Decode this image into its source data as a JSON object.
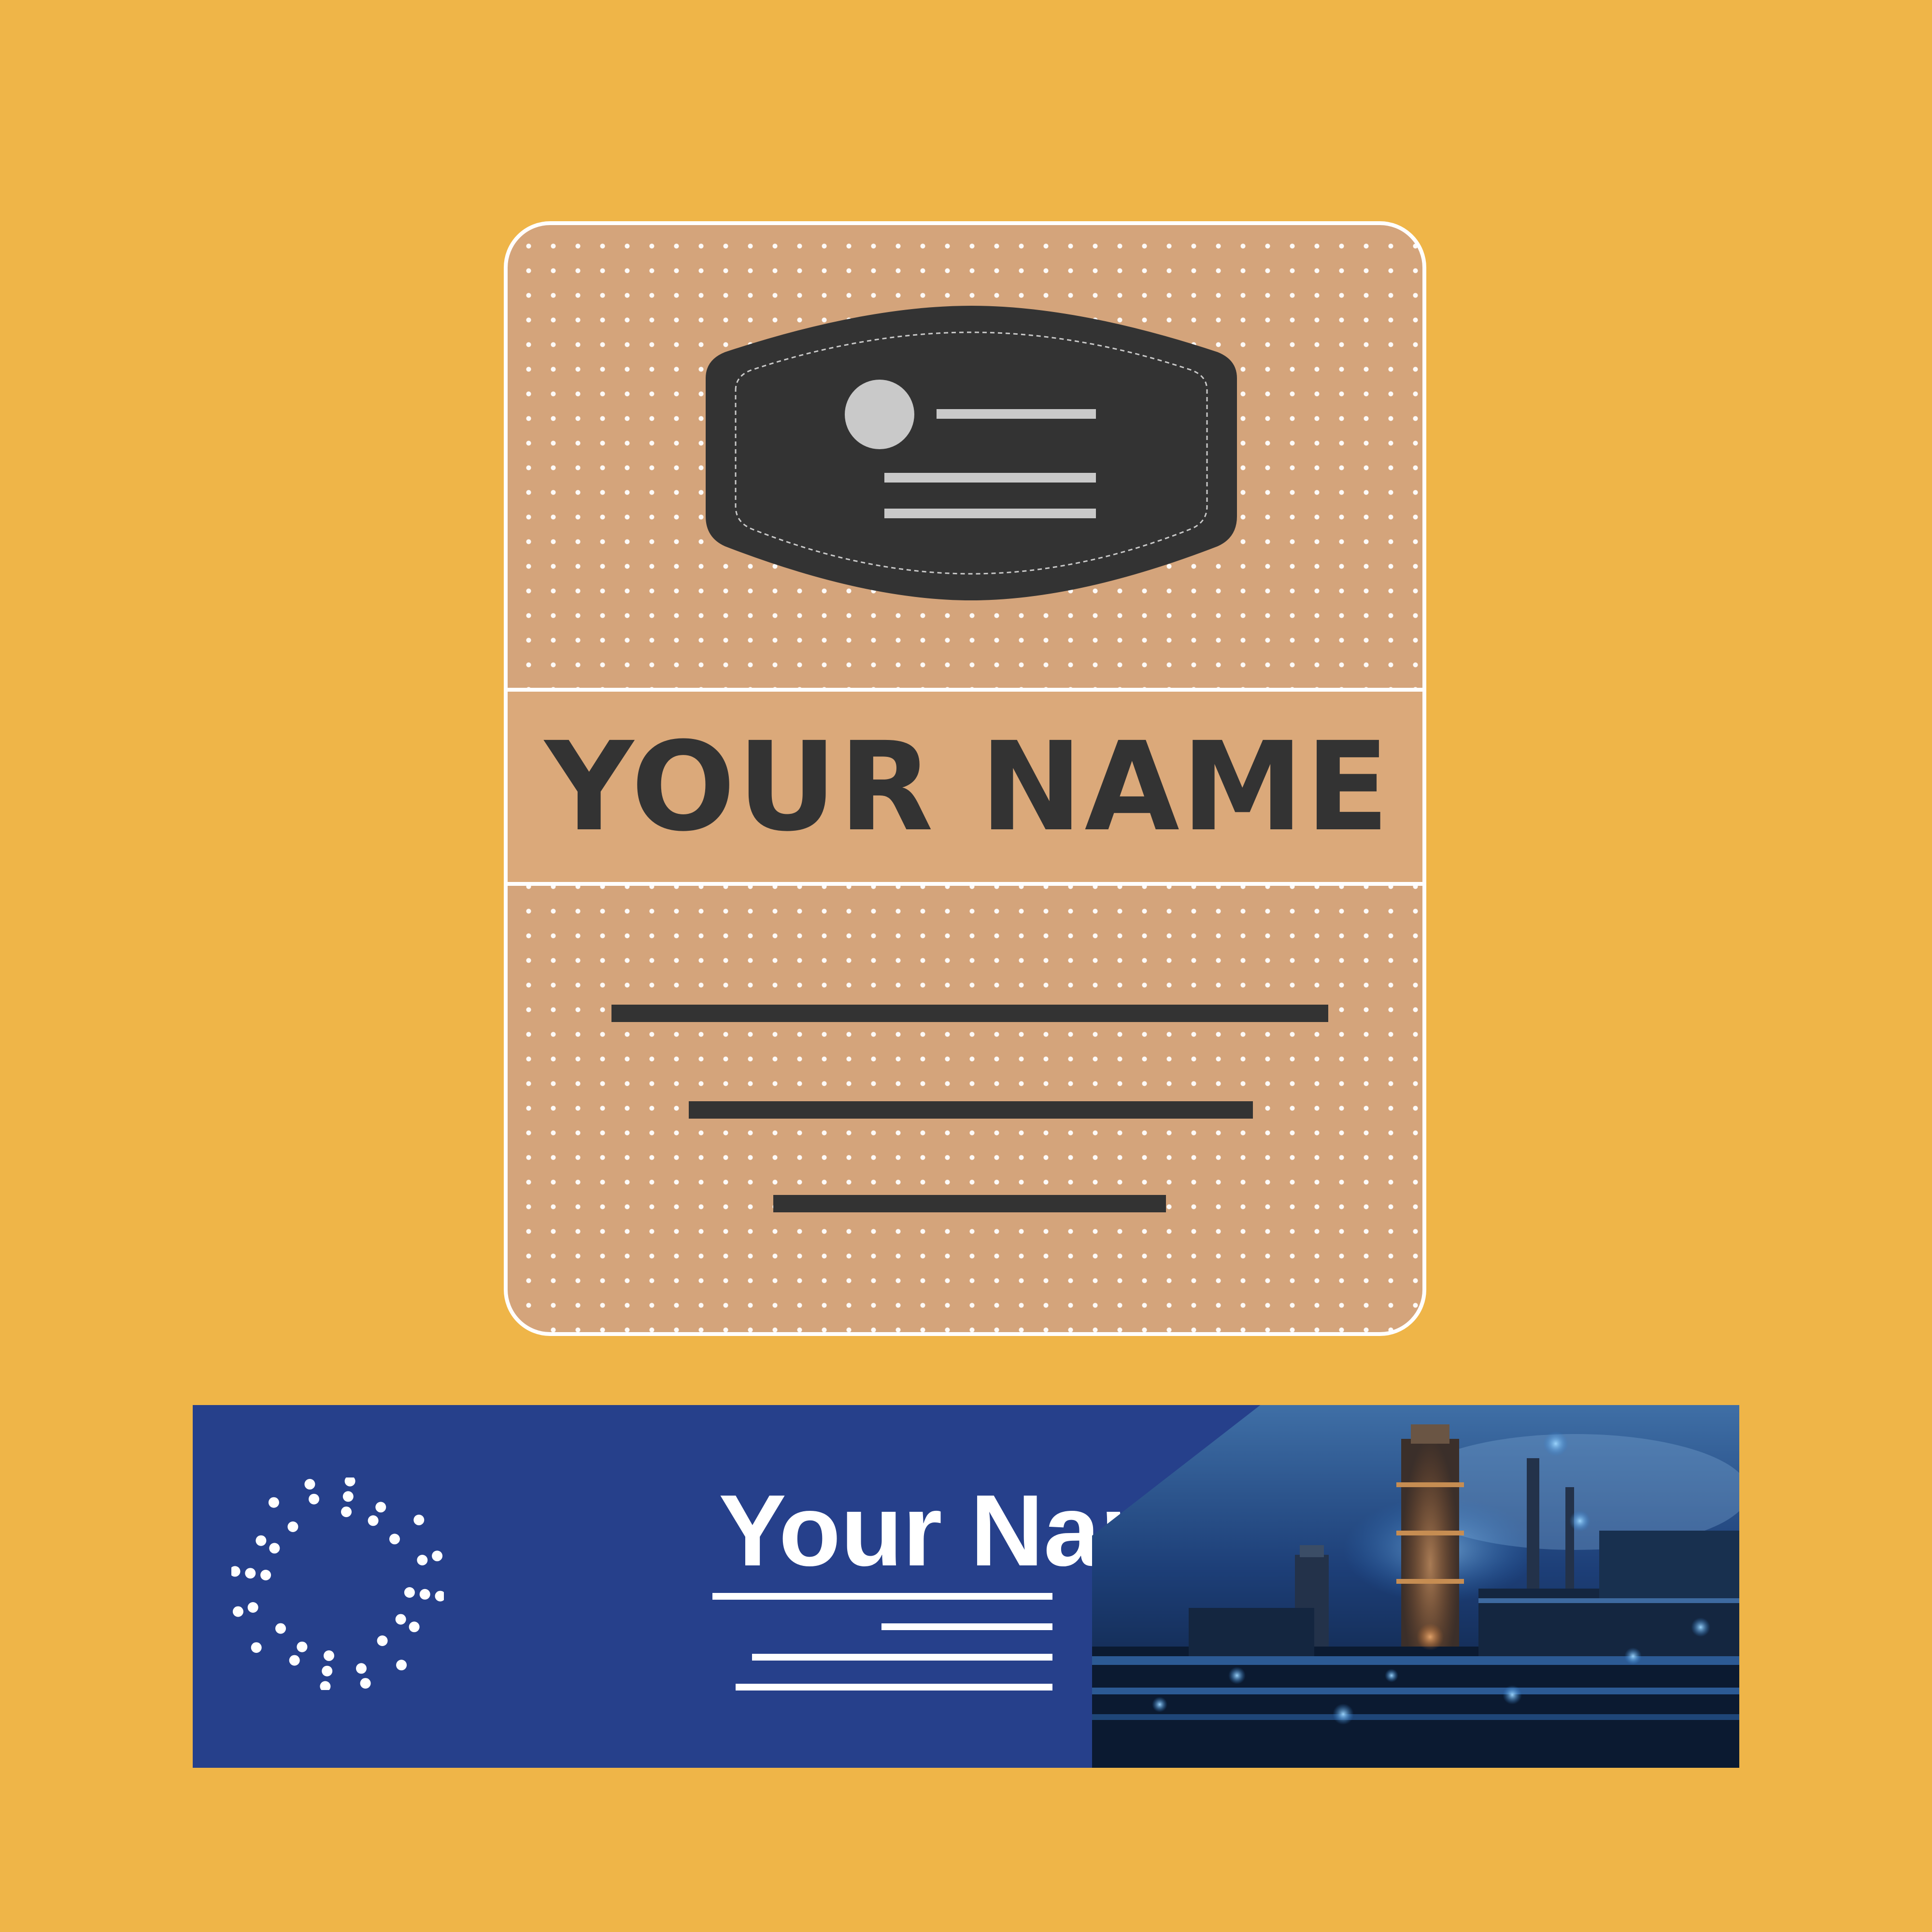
{
  "background_color": "#efb548",
  "badge": {
    "background_color": "#d4a47b",
    "band_color": "#dba97a",
    "text_color": "#333333",
    "name": "YOUR NAME",
    "holder_icon": "id-card-mask-icon"
  },
  "plate": {
    "background_color": "#26408b",
    "name": "Your Name",
    "logo_icon": "dotted-circle-logo-icon",
    "photo_icon": "industrial-plant-photo"
  }
}
